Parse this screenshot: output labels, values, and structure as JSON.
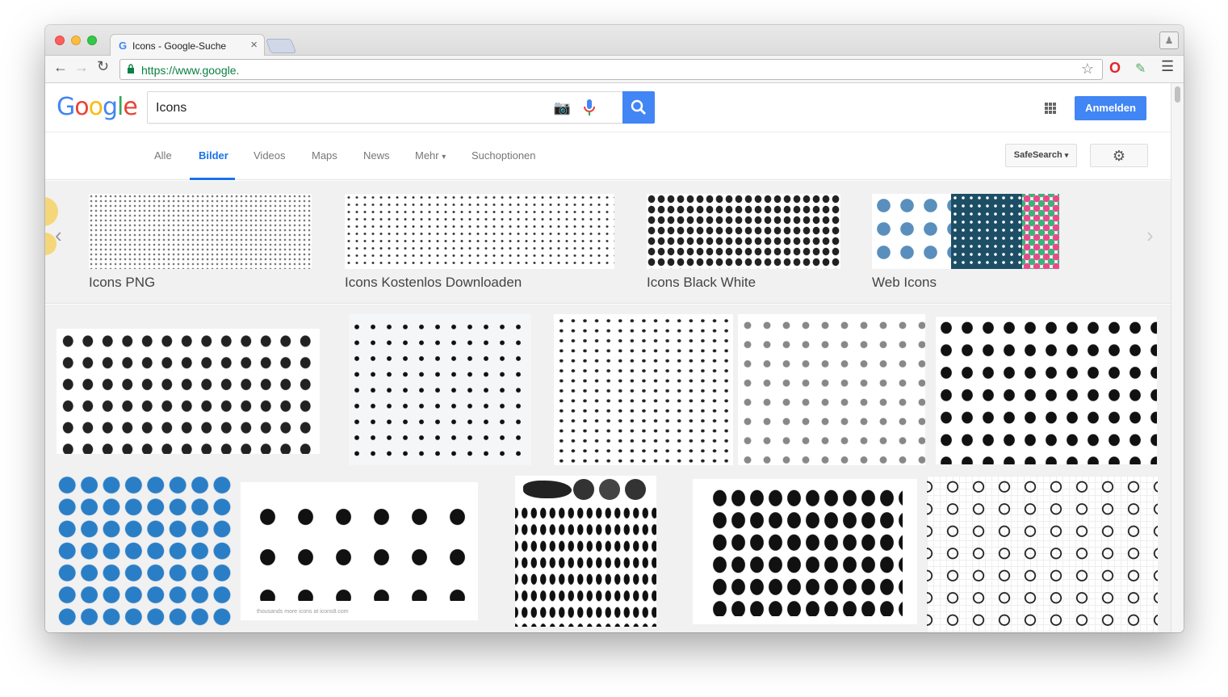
{
  "browser": {
    "tab_title": "Icons - Google-Suche",
    "url": "https://www.google.",
    "tab_close": "×"
  },
  "google": {
    "logo": [
      "G",
      "o",
      "o",
      "g",
      "l",
      "e"
    ],
    "logo_colors": [
      "#4285f4",
      "#ea4335",
      "#fbbc05",
      "#4285f4",
      "#34a853",
      "#ea4335"
    ],
    "query": "Icons",
    "signin_label": "Anmelden"
  },
  "nav": {
    "tabs": [
      "Alle",
      "Bilder",
      "Videos",
      "Maps",
      "News",
      "Mehr",
      "Suchoptionen"
    ],
    "active": "Bilder",
    "safesearch_label": "SafeSearch",
    "more_caret": "▾"
  },
  "related": [
    {
      "label": "Icons PNG"
    },
    {
      "label": "Icons Kostenlos Downloaden"
    },
    {
      "label": "Icons Black White"
    },
    {
      "label": "Web Icons"
    }
  ],
  "results": {
    "icons8_caption": "thousands more icons at icons8.com"
  },
  "colors": {
    "accent": "#4285f4",
    "active_tab": "#1a73e8",
    "social_blue": "#2a7ec6",
    "dark_teal": "#1c4f66"
  }
}
